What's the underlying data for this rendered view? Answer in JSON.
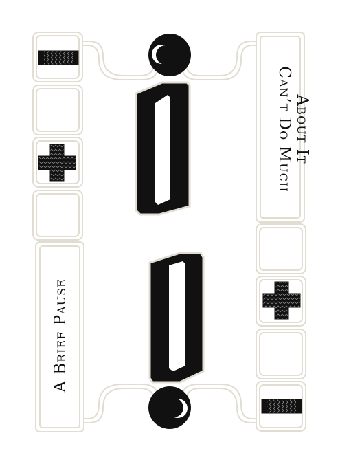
{
  "card": {
    "rank": "0",
    "top_title": {
      "line1": "Can’t Do Much",
      "line2": "About It"
    },
    "bottom_title": "A Brief Pause"
  },
  "icons": {
    "top_left_tab": "striped-bar-icon",
    "left_symbol": "striped-cross-icon",
    "right_symbol": "striped-cross-icon",
    "bottom_right_tab": "striped-bar-icon",
    "top_moon": "crescent-moon-icon",
    "bottom_moon": "crescent-moon-icon"
  },
  "colors": {
    "frame": "#e2ddd2",
    "ink": "#111111",
    "paper": "#ffffff"
  }
}
